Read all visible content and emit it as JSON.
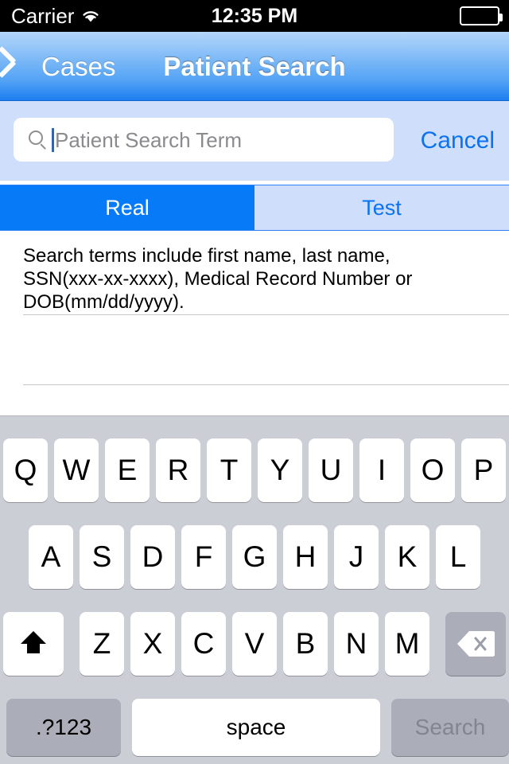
{
  "status_bar": {
    "carrier": "Carrier",
    "time": "12:35 PM",
    "wifi_icon": "wifi-icon",
    "battery_icon": "battery-full-icon"
  },
  "nav_bar": {
    "back_icon": "chevron-left-icon",
    "back_label": "Cases",
    "title": "Patient Search",
    "accent": "#1c7ef0"
  },
  "search_bar": {
    "search_icon": "search-icon",
    "value": "",
    "placeholder": "Patient Search Term",
    "cancel_label": "Cancel",
    "accent": "#0b72f0",
    "background": "#cfdffb"
  },
  "segmented_control": {
    "selected_index": 0,
    "selected_color": "#077bf7",
    "segments": [
      {
        "label": "Real",
        "selected": true
      },
      {
        "label": "Test",
        "selected": false
      }
    ]
  },
  "content": {
    "hint_text": "Search terms include first name, last name,\nSSN(xxx-xx-xxxx), Medical Record Number or\nDOB(mm/dd/yyyy).",
    "separator_color": "#c8c7cc"
  },
  "keyboard": {
    "background": "#ccced5",
    "row1": [
      "Q",
      "W",
      "E",
      "R",
      "T",
      "Y",
      "U",
      "I",
      "O",
      "P"
    ],
    "row2": [
      "A",
      "S",
      "D",
      "F",
      "G",
      "H",
      "J",
      "K",
      "L"
    ],
    "row3": [
      "Z",
      "X",
      "C",
      "V",
      "B",
      "N",
      "M"
    ],
    "shift_icon": "shift-icon",
    "backspace_icon": "backspace-delete-icon",
    "numbers_label": ".?123",
    "space_label": "space",
    "search_label": "Search",
    "search_enabled": false
  }
}
